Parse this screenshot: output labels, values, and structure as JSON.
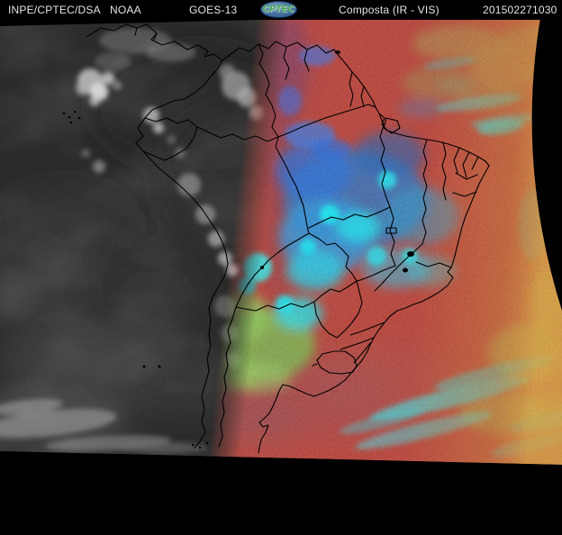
{
  "header": {
    "agency": "INPE/CPTEC/DSA",
    "noaa_label": "NOAA",
    "satellite_label": "GOES-13",
    "logo_text": "CPTEC",
    "product_label": "Composta (IR - VIS)",
    "timestamp": "201502271030"
  },
  "satellite_image": {
    "kind": "Geostationary composite over South America: grayscale visible channel on the west (night/terminator side), false-color enhanced IR on the east, political borders overlaid in black",
    "colors": {
      "header_bg": "#000000",
      "header_text": "#e4e4e4",
      "logo_blue": "#3f6da0",
      "logo_green": "#35a340",
      "vis_base": "#2b2b2b",
      "vis_cloud": "#c8c8c8",
      "ir_warm_red": "#b84a42",
      "ir_limb_orange": "#c98a3e",
      "ir_cloud_blue": "#2e7cc8",
      "ir_cloud_cyan": "#28dce8",
      "ir_cloud_green": "#7cbe58",
      "map_border": "#000000",
      "space_black": "#000000"
    }
  }
}
